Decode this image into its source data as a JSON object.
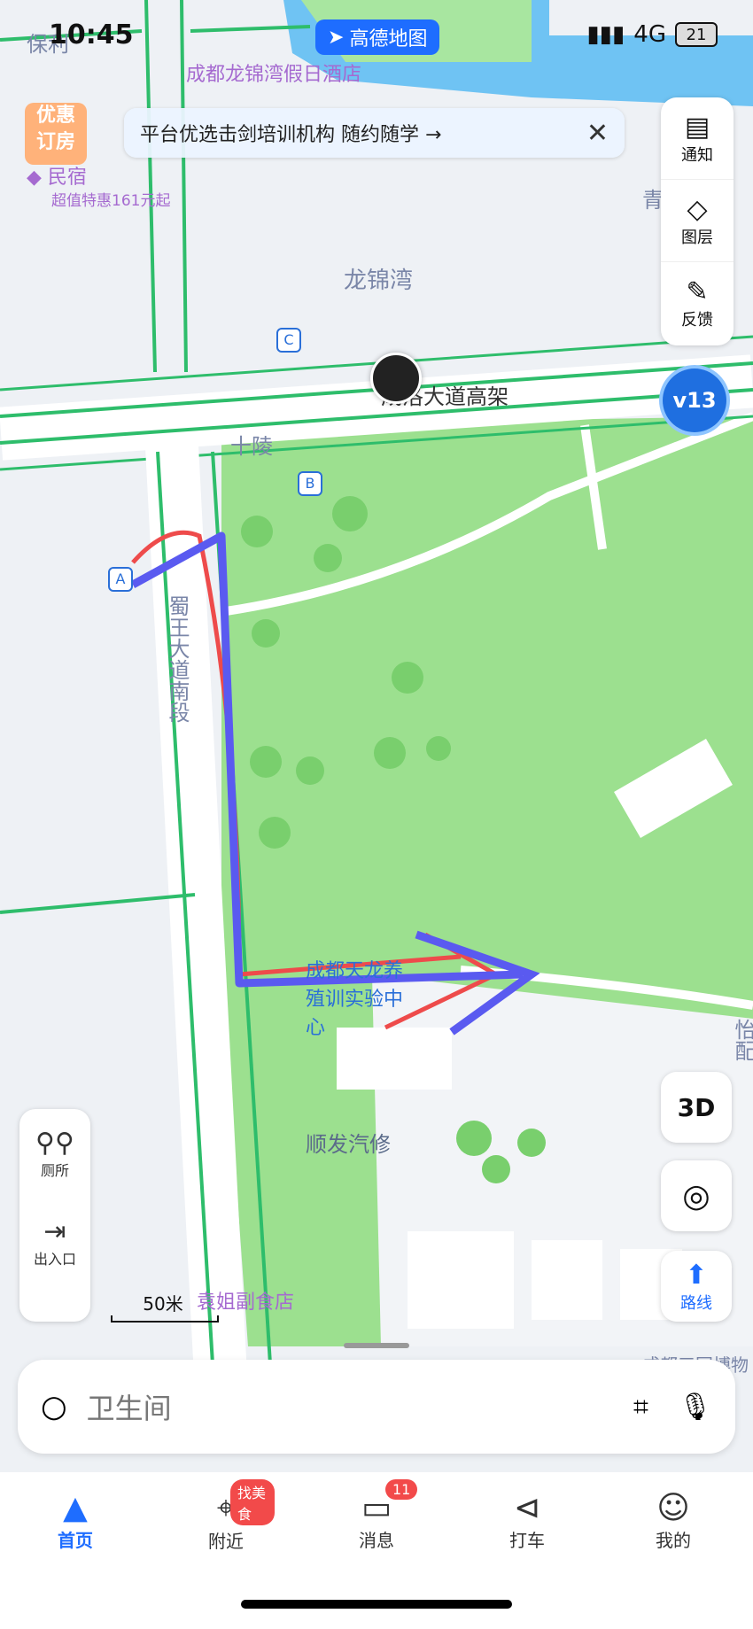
{
  "status_bar": {
    "time": "10:45",
    "network": "4G",
    "battery": "21"
  },
  "app": {
    "name": "高德地图"
  },
  "banner": {
    "text": "平台优选击剑培训机构 随约随学 →"
  },
  "promo": {
    "line1": "优惠",
    "line2": "订房",
    "lodging_label": "民宿",
    "deal_text": "超值特惠161元起"
  },
  "map_labels": {
    "hotel": "成都龙锦湾假日酒店",
    "area": "龙锦湾",
    "highway": "成洛大道高架",
    "road": "蜀王大道南段",
    "station": "十陵",
    "stop_a": "A",
    "stop_b": "B",
    "stop_c": "C",
    "center": "成都天龙养殖训实验中心",
    "repair": "顺发汽修",
    "food": "袁姐副食店",
    "partial_left": "保利",
    "partial_right": "怡配",
    "partial_right2": "青",
    "partial_bottom": "成都三国博物"
  },
  "right_tools": [
    {
      "label": "通知",
      "icon": "notice-icon"
    },
    {
      "label": "图层",
      "icon": "layers-icon"
    },
    {
      "label": "反馈",
      "icon": "feedback-icon"
    }
  ],
  "level_badge": "v13",
  "left_tools": [
    {
      "label": "厕所",
      "icon": "toilet-icon"
    },
    {
      "label": "出入口",
      "icon": "entrance-icon"
    }
  ],
  "map_buttons": {
    "three_d": "3D",
    "route": "路线"
  },
  "scale": "50米",
  "search": {
    "placeholder": "卫生间"
  },
  "tabs": [
    {
      "label": "首页",
      "icon": "home-icon",
      "active": true
    },
    {
      "label": "附近",
      "icon": "nearby-icon",
      "badge": "找美食"
    },
    {
      "label": "消息",
      "icon": "message-icon",
      "badge": "11"
    },
    {
      "label": "打车",
      "icon": "taxi-icon"
    },
    {
      "label": "我的",
      "icon": "profile-icon"
    }
  ],
  "colors": {
    "accent": "#1e6dff",
    "road_green": "#2ebd6b",
    "park": "#9ce08f",
    "sketch_red": "#ee4b4b",
    "sketch_blue": "#5a5af0"
  }
}
